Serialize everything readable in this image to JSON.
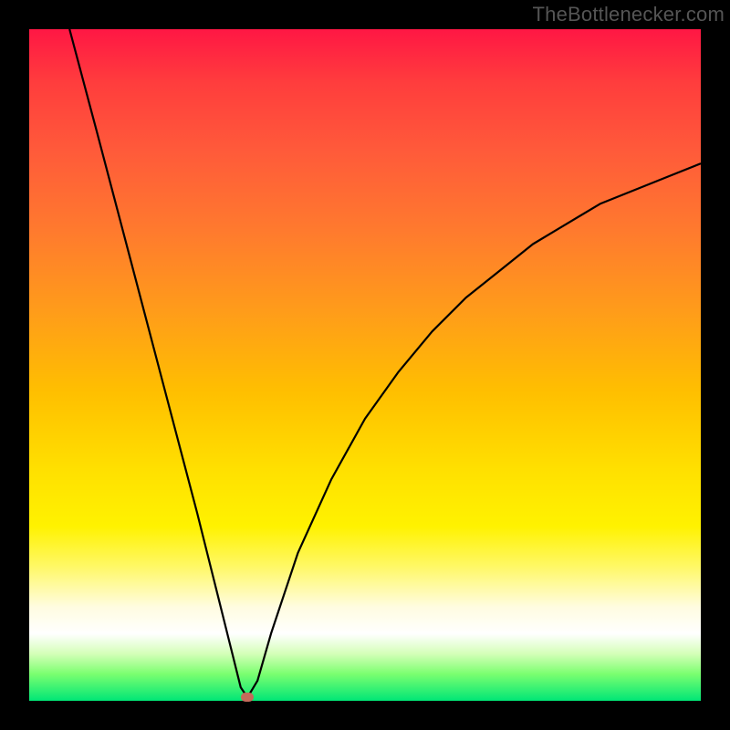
{
  "watermark": "TheBottlenecker.com",
  "chart_data": {
    "type": "line",
    "title": "",
    "xlabel": "",
    "ylabel": "",
    "xlim": [
      0,
      100
    ],
    "ylim": [
      0,
      100
    ],
    "background": "heatmap-gradient",
    "series": [
      {
        "name": "bottleneck-curve",
        "description": "V-shaped curve with minimum near x≈32; left branch near-linear, right branch concave (sqrt-like).",
        "x": [
          6,
          10,
          15,
          20,
          25,
          28,
          30,
          31.5,
          32.5,
          34,
          36,
          40,
          45,
          50,
          55,
          60,
          65,
          70,
          75,
          80,
          85,
          90,
          95,
          100
        ],
        "y": [
          100,
          85,
          66,
          47,
          28,
          16,
          8,
          2,
          0.5,
          3,
          10,
          22,
          33,
          42,
          49,
          55,
          60,
          64,
          68,
          71,
          74,
          76,
          78,
          80
        ]
      }
    ],
    "marker": {
      "name": "optimum-point",
      "x": 32.5,
      "y": 0.5,
      "color": "#c46a5a"
    },
    "gradient_stops": [
      {
        "pos": 0.0,
        "color": "#ff1744"
      },
      {
        "pos": 0.3,
        "color": "#ff7a2e"
      },
      {
        "pos": 0.6,
        "color": "#ffe100"
      },
      {
        "pos": 0.9,
        "color": "#ffffff"
      },
      {
        "pos": 1.0,
        "color": "#00e676"
      }
    ]
  }
}
